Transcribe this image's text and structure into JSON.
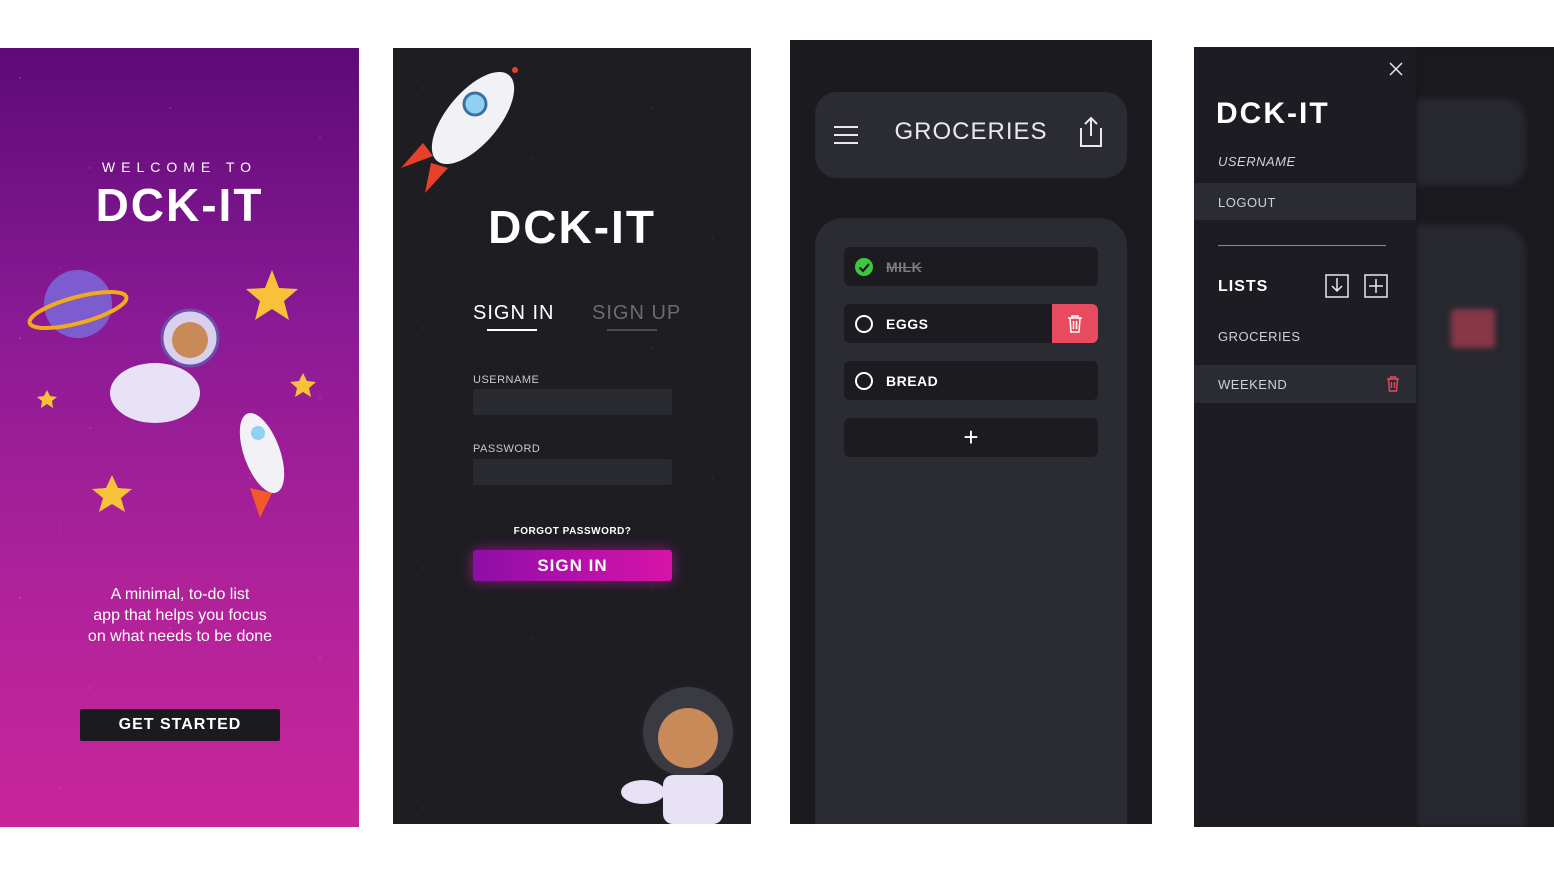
{
  "welcome": {
    "heading": "WELCOME TO",
    "logo": "DCK-IT",
    "tagline": "A minimal, to-do list\napp that helps you focus\non what needs to be done",
    "button": "GET STARTED"
  },
  "signin": {
    "logo": "DCK-IT",
    "tab_signin": "SIGN IN",
    "tab_signup": "SIGN UP",
    "username_label": "USERNAME",
    "password_label": "PASSWORD",
    "forgot": "FORGOT PASSWORD?",
    "button": "SIGN IN"
  },
  "list": {
    "title": "GROCERIES",
    "items": [
      {
        "label": "MILK",
        "done": true
      },
      {
        "label": "EGGS",
        "done": false
      },
      {
        "label": "BREAD",
        "done": false
      }
    ],
    "add_symbol": "+"
  },
  "menu": {
    "logo": "DCK-IT",
    "username": "USERNAME",
    "logout": "LOGOUT",
    "lists_title": "LISTS",
    "lists": [
      "GROCERIES",
      "WEEKEND"
    ]
  },
  "colors": {
    "accent": "#d813a8",
    "danger": "#e84a60",
    "success": "#3ec83e"
  }
}
